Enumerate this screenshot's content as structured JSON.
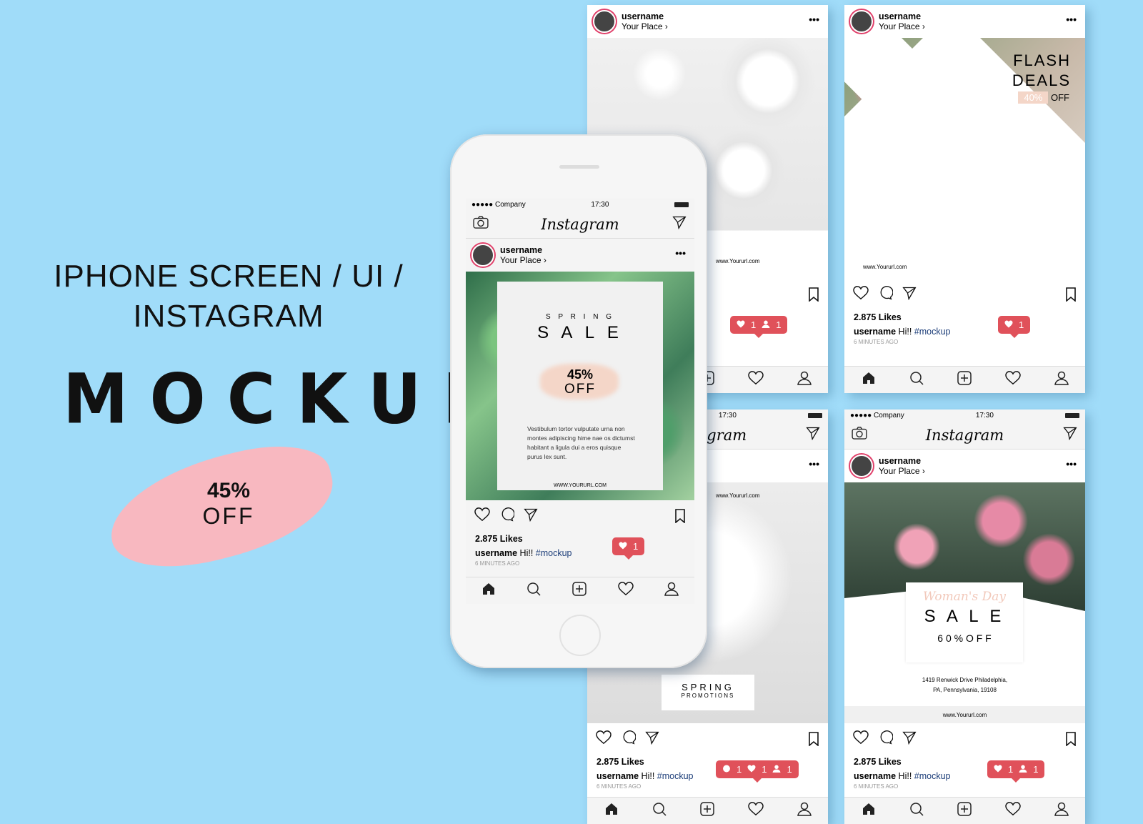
{
  "headline": {
    "line1": "IPHONE SCREEN / UI /",
    "line2": "INSTAGRAM",
    "mockup": "MOCKUP",
    "promo_percent": "45%",
    "promo_off": "OFF"
  },
  "status_bar": {
    "carrier": "●●●●● Company",
    "time": "17:30"
  },
  "app": {
    "logo": "Instagram"
  },
  "post": {
    "username": "username",
    "place": "Your Place ›",
    "likes": "2.875 Likes",
    "caption_user": "username",
    "caption_text": "Hi!!",
    "hashtag": "#mockup",
    "time": "6 MINUTES AGO"
  },
  "colors": {
    "background": "#a0dcf9",
    "badge": "#e0515a",
    "hashtag": "#1e3f7a",
    "brush": "#f8b8c0"
  },
  "screens": [
    {
      "kind": "spring",
      "small": "S P R I N G",
      "big": "S A L E",
      "percent": "45%",
      "off": "OFF",
      "body": "Vestibulum tortor vulputate urna non montes adipiscing hime nae os dictumst habitant a ligula dui a eros quisque purus lex sunt.",
      "url": "WWW.YOURURL.COM",
      "badge": [
        {
          "icon": "heart",
          "count": "1"
        }
      ]
    },
    {
      "kind": "flowers",
      "url": "www.Yoururl.com",
      "badge": [
        {
          "icon": "heart",
          "count": "1"
        },
        {
          "icon": "user",
          "count": "1"
        }
      ]
    },
    {
      "kind": "flash",
      "line1": "FLASH",
      "line2": "DEALS",
      "percent": "40%",
      "off": "OFF",
      "url": "www.Yoururl.com",
      "badge": [
        {
          "icon": "heart",
          "count": "1"
        }
      ]
    },
    {
      "kind": "promo",
      "line1": "SPRING",
      "line2": "PROMOTIONS",
      "url": "www.Yoururl.com",
      "badge": [
        {
          "icon": "comment",
          "count": "1"
        },
        {
          "icon": "heart",
          "count": "1"
        },
        {
          "icon": "user",
          "count": "1"
        }
      ]
    },
    {
      "kind": "woman",
      "script": "Woman's Day",
      "big": "S A L E",
      "off": "6 0 % O F F",
      "addr1": "1419 Renwick Drive Philadelphia,",
      "addr2": "PA, Pennsylvania, 19108",
      "url": "www.Yoururl.com",
      "badge": [
        {
          "icon": "heart",
          "count": "1"
        },
        {
          "icon": "user",
          "count": "1"
        }
      ]
    }
  ]
}
